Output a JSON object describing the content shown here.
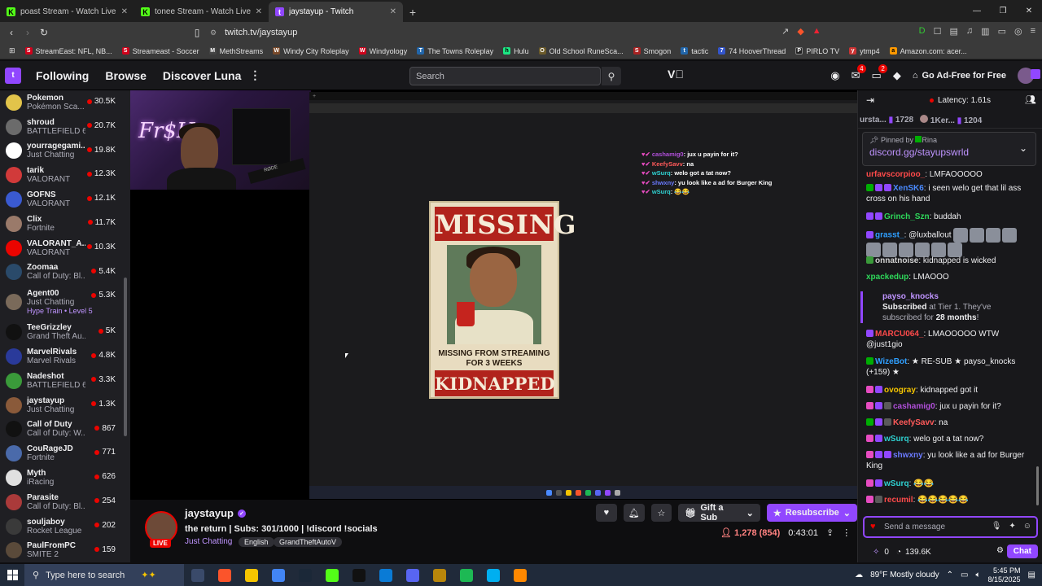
{
  "browser": {
    "tabs": [
      {
        "title": "poast Stream - Watch Live on Kick",
        "icon": "kick-icon",
        "color": "#53fc18",
        "active": false
      },
      {
        "title": "tonee Stream - Watch Live on Kick",
        "icon": "kick-icon",
        "color": "#53fc18",
        "active": false
      },
      {
        "title": "jaystayup - Twitch",
        "icon": "twitch-icon",
        "color": "#9147ff",
        "active": true
      }
    ],
    "url": "twitch.tv/jaystayup",
    "bookmarks": [
      {
        "label": "StreamEast: NFL, NB...",
        "color": "#d0021b"
      },
      {
        "label": "Streameast - Soccer",
        "color": "#d0021b"
      },
      {
        "label": "MethStreams",
        "color": "#444444"
      },
      {
        "label": "Windy City Roleplay",
        "color": "#7a4a2a"
      },
      {
        "label": "Windyology",
        "color": "#d0021b"
      },
      {
        "label": "The Towns Roleplay",
        "color": "#2266aa"
      },
      {
        "label": "Hulu",
        "color": "#1ce783"
      },
      {
        "label": "Old School RuneSca...",
        "color": "#6b5a2a"
      },
      {
        "label": "Smogon",
        "color": "#aa2222"
      },
      {
        "label": "tactic",
        "color": "#2266aa"
      },
      {
        "label": "74 HooverThread",
        "color": "#3355cc"
      },
      {
        "label": "PIRLO TV",
        "color": "#222222"
      },
      {
        "label": "ytmp4",
        "color": "#cc3333"
      },
      {
        "label": "Amazon.com: acer...",
        "color": "#ff9900"
      }
    ]
  },
  "twitch_nav": {
    "logo": "Twitch",
    "links": [
      "Following",
      "Browse",
      "Discover Luna"
    ],
    "search_placeholder": "Search",
    "badges": {
      "notifications": "4",
      "inbox": "2"
    },
    "ad_free": "Go Ad-Free for Free"
  },
  "sidebar": {
    "channels": [
      {
        "name": "Pokemon",
        "game": "Pokémon Sca...",
        "viewers": "30.5K",
        "color": "#e2c44a"
      },
      {
        "name": "shroud",
        "game": "BATTLEFIELD 6",
        "viewers": "20.7K",
        "color": "#6b6b6b"
      },
      {
        "name": "yourragegami...",
        "game": "Just Chatting",
        "viewers": "19.8K",
        "color": "#ffffff"
      },
      {
        "name": "tarik",
        "game": "VALORANT",
        "viewers": "12.3K",
        "color": "#d13a3a"
      },
      {
        "name": "GOFNS",
        "game": "VALORANT",
        "viewers": "12.1K",
        "color": "#3a5ad1"
      },
      {
        "name": "Clix",
        "game": "Fortnite",
        "viewers": "11.7K",
        "color": "#9a7a6a"
      },
      {
        "name": "VALORANT_A...",
        "game": "VALORANT",
        "viewers": "10.3K",
        "color": "#eb0400"
      },
      {
        "name": "Zoomaa",
        "game": "Call of Duty: Bl...",
        "viewers": "5.4K",
        "color": "#2a4a6a"
      },
      {
        "name": "Agent00",
        "game": "Just Chatting",
        "viewers": "5.3K",
        "color": "#7a6a5a",
        "extra": "Hype Train • Level 5"
      },
      {
        "name": "TeeGrizzley",
        "game": "Grand Theft Au...",
        "viewers": "5K",
        "color": "#111111"
      },
      {
        "name": "MarvelRivals",
        "game": "Marvel Rivals",
        "viewers": "4.8K",
        "color": "#2a3a9a"
      },
      {
        "name": "Nadeshot",
        "game": "BATTLEFIELD 6",
        "viewers": "3.3K",
        "color": "#3a9a3a"
      },
      {
        "name": "jaystayup",
        "game": "Just Chatting",
        "viewers": "1.3K",
        "color": "#8a5a3a"
      },
      {
        "name": "Call of Duty",
        "game": "Call of Duty: W...",
        "viewers": "867",
        "color": "#111111"
      },
      {
        "name": "CouRageJD",
        "game": "Fortnite",
        "viewers": "771",
        "color": "#4a6aaa"
      },
      {
        "name": "Myth",
        "game": "iRacing",
        "viewers": "626",
        "color": "#e0e0e0"
      },
      {
        "name": "Parasite",
        "game": "Call of Duty: Bl...",
        "viewers": "254",
        "color": "#aa3a3a"
      },
      {
        "name": "souljaboy",
        "game": "Rocket League",
        "viewers": "202",
        "color": "#3a3a3a"
      },
      {
        "name": "PaulFromPC",
        "game": "SMITE 2",
        "viewers": "159",
        "color": "#5a4a3a"
      }
    ]
  },
  "player": {
    "cam_sign": "Fr$H",
    "overlay_chat": [
      {
        "user": "cashamig0",
        "text": ": jux u payin for it?",
        "color": "#b04fd9"
      },
      {
        "user": "KeefySavv",
        "text": ": na",
        "color": "#ff5a5a"
      },
      {
        "user": "wSurq",
        "text": ": welo got a tat now?",
        "color": "#2fd0d0"
      },
      {
        "user": "shwxny",
        "text": ": yu look like a ad for Burger King",
        "color": "#6a7aff"
      },
      {
        "user": "wSurq",
        "text": ": 😂😂",
        "color": "#2fd0d0"
      }
    ],
    "poster": {
      "top": "MISSING",
      "middle": "MISSING FROM STREAMING FOR 3 WEEKS",
      "bottom": "KIDNAPPED"
    }
  },
  "stream": {
    "streamer": "jaystayup",
    "live": "LIVE",
    "title": "the return | Subs: 301/1000 | !discord !socials",
    "category": "Just Chatting",
    "tags": [
      "English",
      "GrandTheftAutoV"
    ],
    "gift_sub": "Gift a Sub",
    "resubscribe": "Resubscribe",
    "viewers": "1,278 (854)",
    "uptime": "0:43:01"
  },
  "chat": {
    "latency": "Latency: 1.61s",
    "leaderboard": [
      {
        "name": "ursta...",
        "amount": "1728"
      },
      {
        "name": "1Ker...",
        "amount": "1204"
      }
    ],
    "pinned_by": "Pinned by",
    "pinned_author": "Rina",
    "pinned_text": "discord.gg/stayupswrld",
    "messages": [
      {
        "user": "urfavscorpioo_",
        "text": ": LMFAOOOOO",
        "color": "#ff4a4a",
        "badges": []
      },
      {
        "user": "XenSK6",
        "text": ": i seen welo get that lil ass cross on his hand",
        "color": "#4a8aff",
        "badges": [
          "#00ad03",
          "#9147ff",
          "#9147ff"
        ]
      },
      {
        "user": "Grinch_Szn",
        "text": ": buddah",
        "color": "#2ed75a",
        "badges": [
          "#9147ff",
          "#9147ff"
        ]
      },
      {
        "user": "grasst_",
        "text": ": @luxballout",
        "color": "#2f9fff",
        "badges": [
          "#9147ff"
        ]
      },
      {
        "user": "onnatnoise",
        "text": ": kidnapped is wicked",
        "color": "#d2d2d2",
        "badges": [
          "#3a9a3a"
        ]
      },
      {
        "user": "xpackedup",
        "text": ": LMAOOO",
        "color": "#2ed75a",
        "badges": []
      },
      {
        "user": "MARCU064_",
        "text": ": LMAOOOOO WTW @just1gio",
        "color": "#ff4a4a",
        "badges": [
          "#9147ff"
        ]
      },
      {
        "user": "WizeBot",
        "text": ": ★ RE-SUB ★ payso_knocks (+159) ★",
        "color": "#2f9fff",
        "badges": [
          "#00ad03"
        ]
      },
      {
        "user": "ovogray",
        "text": ": kidnapped got it",
        "color": "#f5c400",
        "badges": [
          "#e74cc1",
          "#9147ff"
        ]
      },
      {
        "user": "cashamig0",
        "text": ": jux u payin for it?",
        "color": "#b04fd9",
        "badges": [
          "#e74cc1",
          "#9147ff",
          "#5a5a5a"
        ]
      },
      {
        "user": "KeefySavv",
        "text": ": na",
        "color": "#ff5a5a",
        "badges": [
          "#00ad03",
          "#9147ff",
          "#5a5a5a"
        ]
      },
      {
        "user": "wSurq",
        "text": ": welo got a tat now?",
        "color": "#2fd0d0",
        "badges": [
          "#e74cc1",
          "#9147ff"
        ]
      },
      {
        "user": "shwxny",
        "text": ": yu look like a ad for Burger King",
        "color": "#6a7aff",
        "badges": [
          "#e74cc1",
          "#9147ff",
          "#9147ff"
        ]
      },
      {
        "user": "wSurq",
        "text": ": 😂😂",
        "color": "#2fd0d0",
        "badges": [
          "#e74cc1",
          "#9147ff"
        ]
      },
      {
        "user": "recumil",
        "text": ": 😂😂😂😂😂",
        "color": "#ff4a4a",
        "badges": [
          "#e74cc1",
          "#5a5a5a"
        ]
      }
    ],
    "sub_notice": {
      "user": "payso_knocks",
      "text_a": "Subscribed",
      "text_b": " at Tier 1. They've subscribed for ",
      "months": "28 months",
      "end": "!"
    },
    "input_placeholder": "Send a message",
    "bits": "0",
    "points": "139.6K",
    "chat_button": "Chat"
  },
  "taskbar": {
    "search_placeholder": "Type here to search",
    "weather": "89°F  Mostly cloudy",
    "time": "5:45 PM",
    "date": "8/15/2025",
    "apps": [
      {
        "name": "task-view-icon",
        "color": "#3a4a6a"
      },
      {
        "name": "brave-icon",
        "color": "#fb542b"
      },
      {
        "name": "file-explorer-icon",
        "color": "#f5c400"
      },
      {
        "name": "chrome-icon",
        "color": "#4285f4"
      },
      {
        "name": "steam-icon",
        "color": "#1b2838"
      },
      {
        "name": "kick-icon",
        "color": "#53fc18"
      },
      {
        "name": "x-icon",
        "color": "#111111"
      },
      {
        "name": "edge-icon",
        "color": "#0a7bd6"
      },
      {
        "name": "discord-icon",
        "color": "#5865f2"
      },
      {
        "name": "game-icon",
        "color": "#b8860b"
      },
      {
        "name": "spotify-icon",
        "color": "#1db954"
      },
      {
        "name": "skype-icon",
        "color": "#00aff0"
      },
      {
        "name": "vlc-icon",
        "color": "#ff8800"
      }
    ]
  }
}
